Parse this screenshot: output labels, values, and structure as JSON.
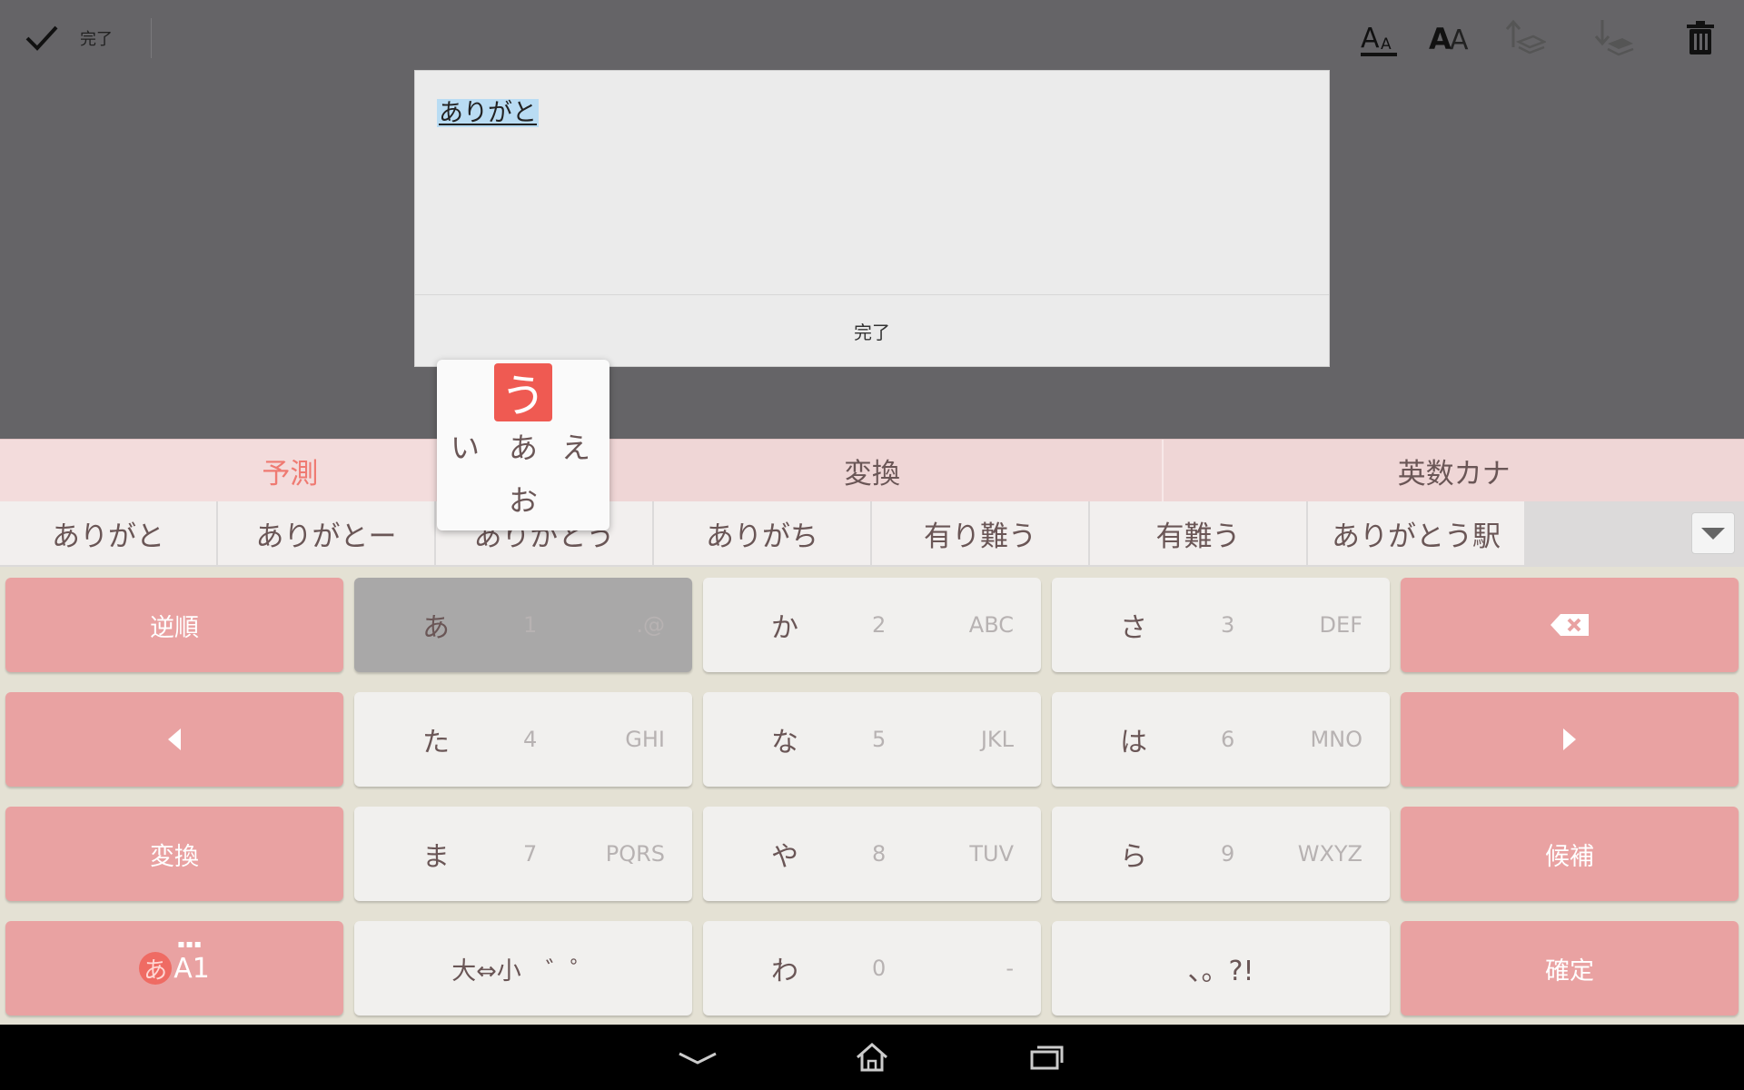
{
  "toolbar": {
    "done_label": "完了",
    "icons": [
      "checkmark-icon",
      "text-small-icon",
      "text-large-icon",
      "layer-up-icon",
      "layer-down-icon",
      "trash-icon"
    ]
  },
  "dialog": {
    "composing_text": "ありがと",
    "done_label": "完了"
  },
  "keyboard": {
    "tabs": [
      {
        "label": "予測",
        "active": true
      },
      {
        "label": "変換",
        "active": false
      },
      {
        "label": "英数カナ",
        "active": false
      }
    ],
    "candidates": [
      "ありがと",
      "ありがとー",
      "ありがとう",
      "ありがち",
      "有り難う",
      "有難う",
      "ありがとう駅"
    ],
    "flick": {
      "up": "う",
      "left": "い",
      "center": "あ",
      "right": "え",
      "down": "お"
    },
    "keys": {
      "reverse": "逆順",
      "convert": "変換",
      "candidates": "候補",
      "confirm": "確定",
      "mode_kana": "あ",
      "mode_rest": "A1",
      "r1": [
        {
          "main": "あ",
          "num": "1",
          "alpha": ".@"
        },
        {
          "main": "か",
          "num": "2",
          "alpha": "ABC"
        },
        {
          "main": "さ",
          "num": "3",
          "alpha": "DEF"
        }
      ],
      "r2": [
        {
          "main": "た",
          "num": "4",
          "alpha": "GHI"
        },
        {
          "main": "な",
          "num": "5",
          "alpha": "JKL"
        },
        {
          "main": "は",
          "num": "6",
          "alpha": "MNO"
        }
      ],
      "r3": [
        {
          "main": "ま",
          "num": "7",
          "alpha": "PQRS"
        },
        {
          "main": "や",
          "num": "8",
          "alpha": "TUV"
        },
        {
          "main": "ら",
          "num": "9",
          "alpha": "WXYZ"
        }
      ],
      "r4": {
        "small_key": "大⇔小　゛゜",
        "wa": {
          "main": "わ",
          "num": "0",
          "alpha": "-"
        },
        "punct": "、。?!"
      }
    },
    "colors": {
      "accent": "#ef5a52",
      "function_key": "#e9a2a2",
      "key": "#f1f0ee"
    }
  },
  "navbar": {
    "icons": [
      "back-icon",
      "home-icon",
      "recents-icon"
    ]
  }
}
